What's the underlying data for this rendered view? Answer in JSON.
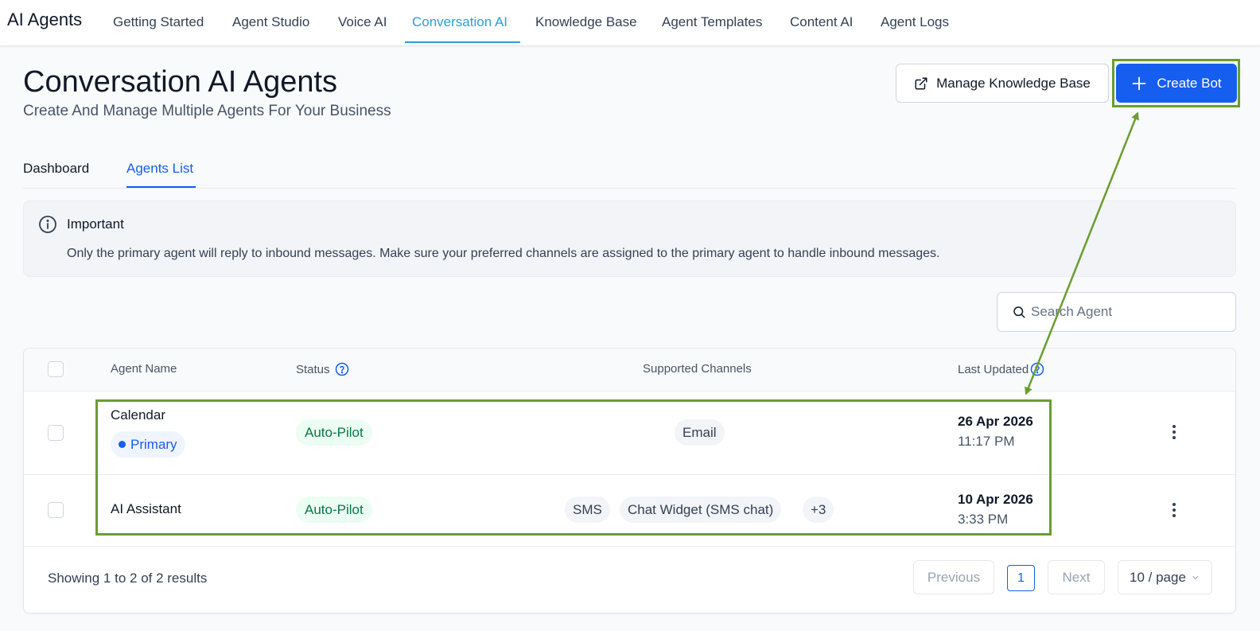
{
  "nav": {
    "brand": "AI Agents",
    "tabs": [
      {
        "label": "Getting Started"
      },
      {
        "label": "Agent Studio"
      },
      {
        "label": "Voice AI"
      },
      {
        "label": "Conversation AI"
      },
      {
        "label": "Knowledge Base"
      },
      {
        "label": "Agent Templates"
      },
      {
        "label": "Content AI"
      },
      {
        "label": "Agent Logs"
      }
    ],
    "active_tab": "Conversation AI"
  },
  "header": {
    "title": "Conversation AI Agents",
    "subtitle": "Create And Manage Multiple Agents For Your Business",
    "manage_kb_label": "Manage Knowledge Base",
    "manage_kb_icon": "external-link-icon",
    "create_bot_label": "Create Bot",
    "create_bot_icon": "plus-icon"
  },
  "subtabs": {
    "dashboard": "Dashboard",
    "agents_list": "Agents List",
    "active": "Agents List"
  },
  "alert": {
    "icon": "info-icon",
    "title": "Important",
    "text": "Only the primary agent will reply to inbound messages. Make sure your preferred channels are assigned to the primary agent to handle inbound messages."
  },
  "search": {
    "placeholder": "Search Agent",
    "value": ""
  },
  "table": {
    "columns": {
      "agent_name": "Agent Name",
      "status": "Status",
      "supported_channels": "Supported Channels",
      "last_updated": "Last Updated"
    },
    "rows": [
      {
        "name": "Calendar",
        "badge": "Primary",
        "status": "Auto-Pilot",
        "channels": [
          "Email"
        ],
        "date": "26 Apr 2026",
        "time": "11:17 PM"
      },
      {
        "name": "AI Assistant",
        "badge": "",
        "status": "Auto-Pilot",
        "channels": [
          "SMS",
          "Chat Widget (SMS chat)",
          "+3"
        ],
        "date": "10 Apr 2026",
        "time": "3:33 PM"
      }
    ]
  },
  "footer": {
    "showing": "Showing 1 to 2 of 2 results",
    "previous": "Previous",
    "page": "1",
    "next": "Next",
    "page_size": "10 / page"
  },
  "colors": {
    "accent": "#155eef",
    "nav_active": "#2a9fd8",
    "status_green": "#067647",
    "annotation": "#6a9e2f"
  }
}
